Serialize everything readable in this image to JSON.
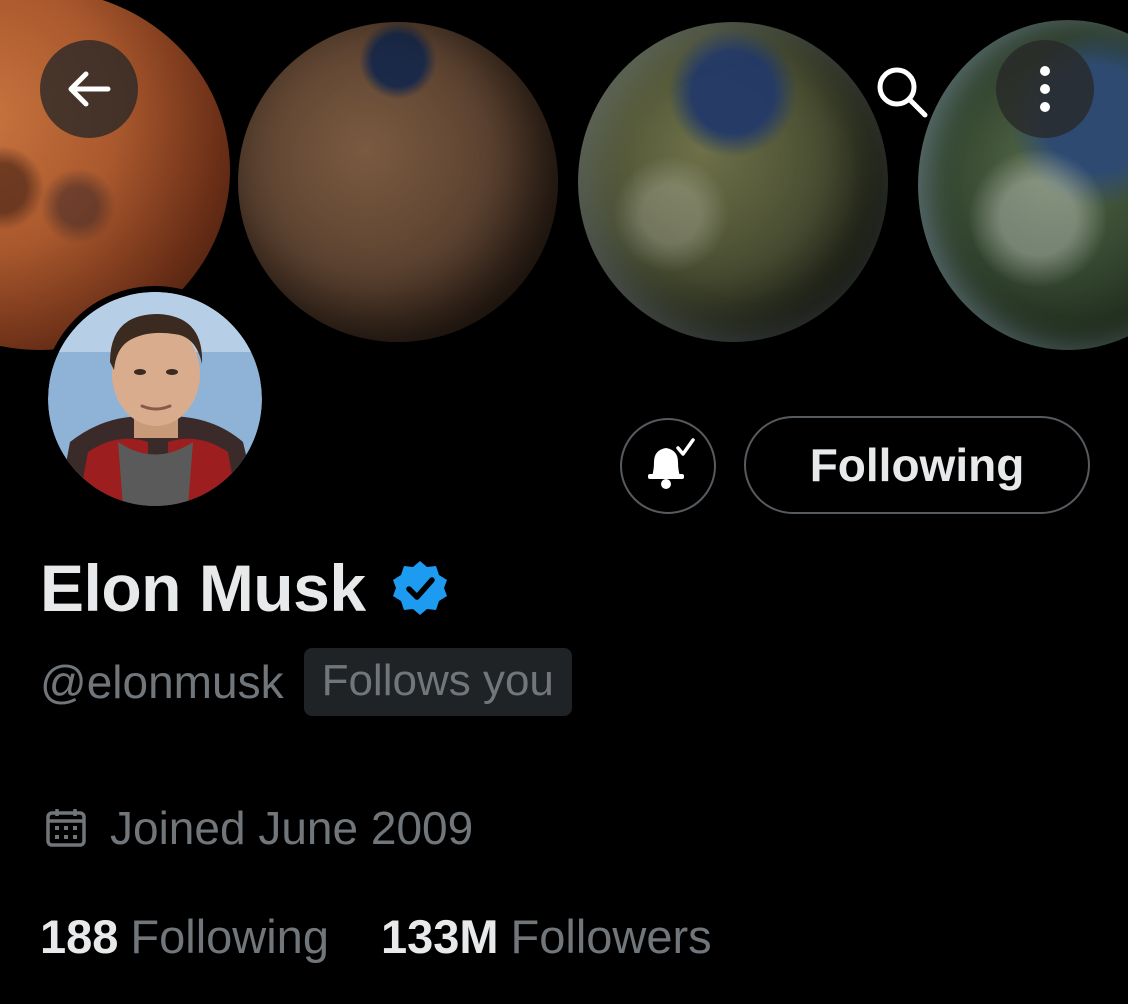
{
  "header": {
    "back_icon": "arrow-left-icon",
    "search_icon": "search-icon",
    "more_icon": "more-vertical-icon"
  },
  "profile": {
    "display_name": "Elon Musk",
    "verified": true,
    "verified_color": "#1d9bf0",
    "handle": "@elonmusk",
    "follows_you_label": "Follows you",
    "joined_text": "Joined June 2009",
    "stats": {
      "following_count": "188",
      "following_label": "Following",
      "followers_count": "133M",
      "followers_label": "Followers"
    }
  },
  "actions": {
    "notifications_icon": "bell-check-icon",
    "follow_button_label": "Following"
  },
  "colors": {
    "background": "#000000",
    "text_primary": "#e7e9ea",
    "text_secondary": "#71767b",
    "border": "#565b60"
  }
}
